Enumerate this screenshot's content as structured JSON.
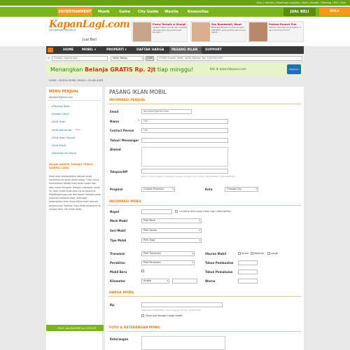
{
  "toplinks": "Iklan | Hombe | Ketentuan Layanan | Karir | Kontak | Sitemap | RSS | Fanl",
  "categories": {
    "entertainment": "ENTERTAINMENT",
    "musik": "Musik",
    "game": "Game",
    "city_guide": "City Guide",
    "wanita": "Wanita",
    "komunitas": "Komunitas",
    "jual_beli": "JUAL BELI",
    "bola": "BOLA"
  },
  "logo": {
    "title": "KapanLagi.com",
    "tagline": "Kita Nikmati bersama",
    "sub": "Jual Beli"
  },
  "ads": [
    {
      "title": "Posisi Terbaik si Mungil",
      "body": "Apakah kalian mungil jadi masalah dla pasangan yang bertanya? Mungkin ...",
      "img": "ad-thumb"
    },
    {
      "title": "Sex Bombshell, Wow!",
      "body": "Bahwasa Berremu untuk menjadi THE BEST yang penting harus bisa dapat ...",
      "img": "ad-thumb"
    },
    {
      "title": "Fantasi Favorit Pria",
      "body": "Hiburan apa saja yang digelar di lain? Jadi cara dia ini?",
      "img": "ad-thumb"
    }
  ],
  "nav": {
    "home": "HOME",
    "mobil": "MOBIL ▾",
    "properti": "PROPERTI ▾",
    "daftar_harga": "DAFTAR HARGA",
    "pasang_iklan": "PASANG IKLAN",
    "support": "SUPPORT"
  },
  "search": {
    "placeholder": "Contoh: honda jazz",
    "category": "Mobil Bekas",
    "button": "CARI",
    "example": "(*100) Suzuki, Swift, 2008, Bekasi, Rp. 120.000.000"
  },
  "banner": {
    "text_pre": "Menangkan ",
    "text_bold": "Belanja GRATIS Rp. 2jt",
    "text_post": " tiap minggu!",
    "url": "Beli di www.klikpasar.com",
    "logo": "Klikpasar"
  },
  "breadcrumb": "HOME » BURSA MOBIL BEKAS » IKLAN USER",
  "sidebar": {
    "menu_title": "MENU PENJUAL",
    "email": "abyfajar@gmail.com",
    "items": [
      "Pasang Iklan",
      "Sedot Laku?",
      "Edit Iklan",
      "Edit Komentar",
      "Edit Iklan Favorit",
      "Edit Profil",
      "Kembali ke Home"
    ],
    "badge_new": "baru",
    "promo_title": "IKLAN GRATIS TAYANG TERUS SAMPAI LAKU",
    "promo_text": "Kami akan mengirimkan sebuah email konfirmasi ke email Anda setiap 7 hari untuk memastikan bahwa iklan Anda sudah laku atau masih tersedia. Dengan merespon email ini, iklan mobil Anda akan terus tayang di MobilKapanLagi.com dan tampil kembali pada halaman halaman awal. Sehingga kesempatan iklan Anda dilihat lebih banyak pengunjung. Pastikan iklan Anda tayang terus sampai laku. Cek email Anda.",
    "halo": "HALO abyfajar88 | ► LOGOUT"
  },
  "main": {
    "title": "PASANG IKLAN MOBIL",
    "informasi_penjual": "INFORMASI PENJUAL",
    "labels": {
      "email": "Email",
      "nama": "Nama",
      "contact_person": "Contact Person",
      "yahoo": "Yahoo! Messenger",
      "alamat": "Alamat",
      "telepon": "Telepon/HP",
      "propinsi": "Propinsi",
      "kota": "Kota"
    },
    "values": {
      "email": "abyfajar@gmail.com",
      "nama": "Her",
      "contact_person": "Her",
      "propinsi": "Choose Province",
      "kota": "Choose City"
    },
    "telepon_hint": "Bisa 3 nomor telepon, pisahkan dengan tanda koma\ncontoh: 0210456897, 08154659725",
    "informasi_mobil": "INFORMASI MOBIL",
    "mobil_labels": {
      "nopol": "Nopol",
      "merk": "Merk Mobil",
      "seri": "Seri Mobil",
      "tipe": "Tipe Mobil",
      "transmisi": "Transmisi",
      "perakitan": "Perakitan",
      "mobil_baru": "Mobil Baru",
      "kilometer": "Kilometer",
      "ukuran": "Ukuran Mobil",
      "tahun_pembuatan": "Tahun Pembuatan",
      "tahun_pemakaian": "Tahun Pemakaian",
      "warna": "Warna"
    },
    "nopol_hint": "Centang bila nopol tidak ingin ditampilkan",
    "mobil_values": {
      "merk": "Pilih Merk",
      "seri": "Pilih Series",
      "tipe": "Pilih Type",
      "transmisi": "Pilih Transmisi",
      "perakitan": "Pilih Perakitan",
      "kilometer": "Angka"
    },
    "ukuran_options": [
      "Small",
      "Medium",
      "Large"
    ],
    "harga_mobil": "HARGA MOBIL",
    "rp": "Rp.",
    "harga_hint": "Kelipatan 100000000, artinya harga jual Rp. 50.000.000",
    "nego": "Saya jual dengan harga kredit",
    "foto_title": "FOTO & KETERANGAN MOBIL",
    "keterangan": "Keterangan"
  }
}
